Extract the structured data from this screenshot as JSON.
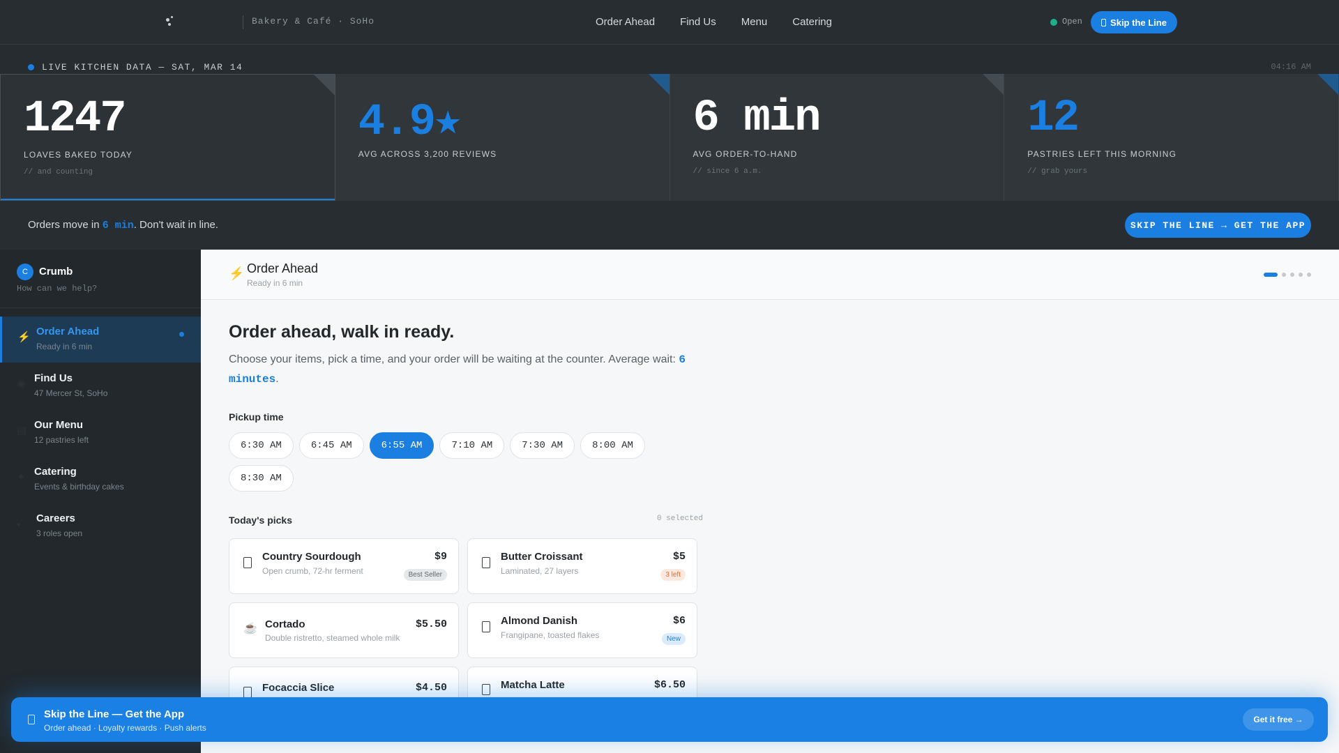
{
  "nav": {
    "brand_sub": "Bakery & Café · SoHo",
    "links": [
      "Order Ahead",
      "Find Us",
      "Menu",
      "Catering"
    ],
    "status": "Open",
    "cta": "Skip the Line"
  },
  "live": {
    "label": "LIVE KITCHEN DATA — SAT, MAR 14",
    "time": "04:16 AM"
  },
  "stats": [
    {
      "value": "1247",
      "label": "LOAVES BAKED TODAY",
      "note": "// and counting"
    },
    {
      "value": "4.9★",
      "label": "AVG ACROSS 3,200 REVIEWS",
      "note": ""
    },
    {
      "value": "6 min",
      "label": "AVG ORDER-TO-HAND",
      "note": "// since 6 a.m."
    },
    {
      "value": "12",
      "label": "PASTRIES LEFT THIS MORNING",
      "note": "// grab yours"
    }
  ],
  "banner": {
    "text_before": "Orders move in ",
    "highlight": "6 min",
    "text_after": ". Don't wait in line.",
    "cta": "SKIP THE LINE → GET THE APP"
  },
  "sidebar": {
    "avatar": "C",
    "name": "Crumb",
    "help": "How can we help?",
    "items": [
      {
        "title": "Order Ahead",
        "sub": "Ready in 6 min",
        "icon": "⚡"
      },
      {
        "title": "Find Us",
        "sub": "47 Mercer St, SoHo",
        "icon": "◉"
      },
      {
        "title": "Our Menu",
        "sub": "12 pastries left",
        "icon": "▤"
      },
      {
        "title": "Catering",
        "sub": "Events & birthday cakes",
        "icon": "✦"
      },
      {
        "title": "Careers",
        "sub": "3 roles open",
        "icon": "●"
      }
    ]
  },
  "main": {
    "header_icon": "⚡",
    "header_title": "Order Ahead",
    "header_sub": "Ready in 6 min",
    "heading": "Order ahead, walk in ready.",
    "desc_before": "Choose your items, pick a time, and your order will be waiting at the counter. Average wait: ",
    "desc_highlight": "6 minutes",
    "desc_after": ".",
    "pickup_label": "Pickup time",
    "times": [
      "6:30 AM",
      "6:45 AM",
      "6:55 AM",
      "7:10 AM",
      "7:30 AM",
      "8:00 AM",
      "8:30 AM"
    ],
    "selected_time": "6:55 AM",
    "picks_label": "Today's picks",
    "picks_count": "0 selected",
    "picks": [
      {
        "name": "Country Sourdough",
        "desc": "Open crumb, 72-hr ferment",
        "price": "$9",
        "badge": "Best Seller"
      },
      {
        "name": "Butter Croissant",
        "desc": "Laminated, 27 layers",
        "price": "$5",
        "badge": "3 left"
      },
      {
        "name": "Cortado",
        "desc": "Double ristretto, steamed whole milk",
        "price": "$5.50",
        "badge": ""
      },
      {
        "name": "Almond Danish",
        "desc": "Frangipane, toasted flakes",
        "price": "$6",
        "badge": "New"
      },
      {
        "name": "Focaccia Slice",
        "desc": "",
        "price": "$4.50",
        "badge": ""
      },
      {
        "name": "Matcha Latte",
        "desc": "",
        "price": "$6.50",
        "badge": ""
      }
    ]
  },
  "appbar": {
    "title": "Skip the Line — Get the App",
    "sub": "Order ahead · Loyalty rewards · Push alerts",
    "cta": "Get it free →"
  },
  "colors": {
    "accent": "#1a7fe0",
    "open": "#1bb28a",
    "dark": "#262c30"
  }
}
